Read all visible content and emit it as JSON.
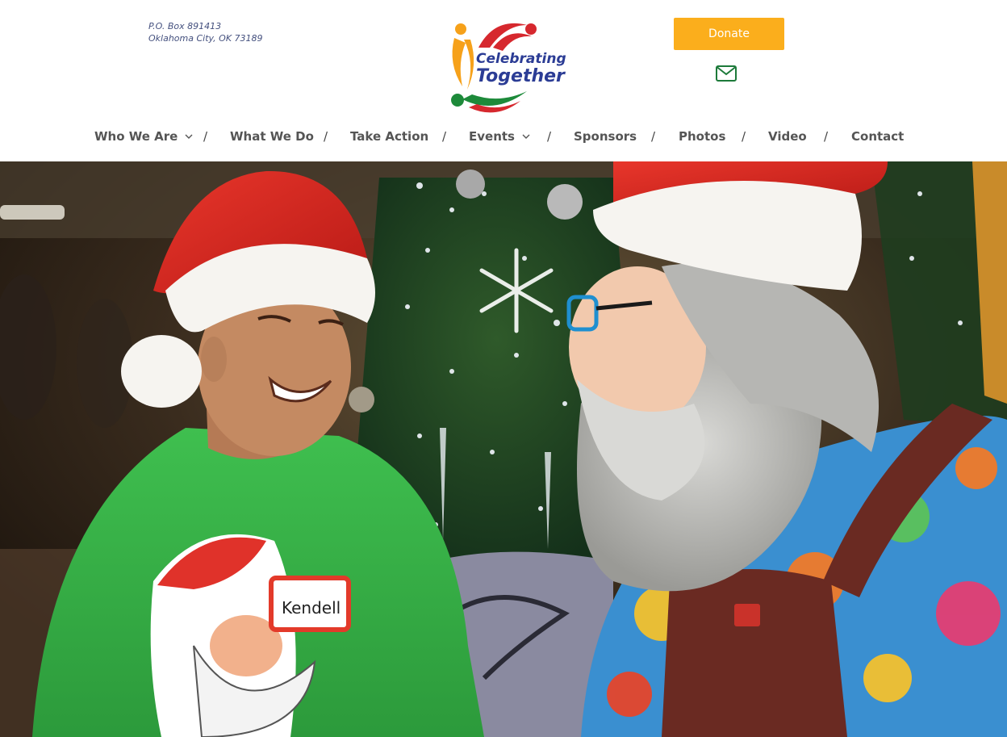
{
  "header": {
    "address": {
      "line1": "P.O. Box 891413",
      "line2": "Oklahoma City, OK 73189"
    },
    "logo": {
      "line1": "Celebrating",
      "line2": "Together"
    },
    "donate_label": "Donate",
    "mail_icon": "envelope-icon"
  },
  "nav": {
    "items": [
      {
        "label": "Who We Are",
        "has_dropdown": true
      },
      {
        "label": "What We Do",
        "has_dropdown": false
      },
      {
        "label": "Take Action",
        "has_dropdown": false
      },
      {
        "label": "Events",
        "has_dropdown": true
      },
      {
        "label": "Sponsors",
        "has_dropdown": false
      },
      {
        "label": "Photos",
        "has_dropdown": false
      },
      {
        "label": "Video",
        "has_dropdown": false
      },
      {
        "label": "Contact",
        "has_dropdown": false
      }
    ],
    "separator": "/"
  },
  "hero": {
    "name_tag": "Kendell"
  },
  "colors": {
    "donate": "#fbae1c",
    "nav_text": "#555555",
    "address_text": "#44507e",
    "logo_blue": "#2b3c95",
    "logo_red": "#d6282e",
    "logo_green": "#1d8a3a",
    "logo_orange": "#f6a11a"
  }
}
